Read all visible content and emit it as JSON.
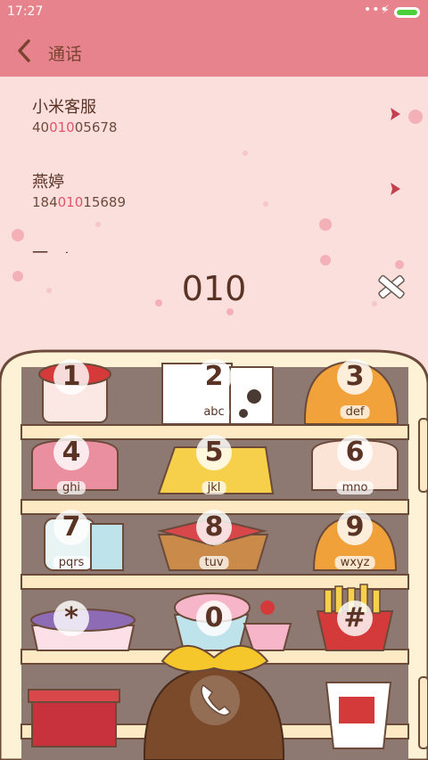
{
  "status_bar": {
    "time": "17:27",
    "dots": "•••",
    "bolt": "⚡"
  },
  "header": {
    "title": "通话"
  },
  "contacts": [
    {
      "name": "小米客服",
      "number_pre": "40",
      "number_match": "010",
      "number_post": "05678"
    },
    {
      "name": "燕婷",
      "number_pre": "184",
      "number_match": "010",
      "number_post": "15689"
    }
  ],
  "peek_name": "一 - ·",
  "dial_input": {
    "value": "010"
  },
  "keypad": [
    {
      "num": "1",
      "letters": ""
    },
    {
      "num": "2",
      "letters": "abc"
    },
    {
      "num": "3",
      "letters": "def"
    },
    {
      "num": "4",
      "letters": "ghi"
    },
    {
      "num": "5",
      "letters": "jkl"
    },
    {
      "num": "6",
      "letters": "mno"
    },
    {
      "num": "7",
      "letters": "pqrs"
    },
    {
      "num": "8",
      "letters": "tuv"
    },
    {
      "num": "9",
      "letters": "wxyz"
    },
    {
      "num": "*",
      "letters": ""
    },
    {
      "num": "0",
      "letters": ""
    },
    {
      "num": "#",
      "letters": ""
    }
  ],
  "colors": {
    "header": "#e6838c",
    "background": "#fbdfdd",
    "highlight": "#e0546a",
    "text": "#5a3324"
  }
}
